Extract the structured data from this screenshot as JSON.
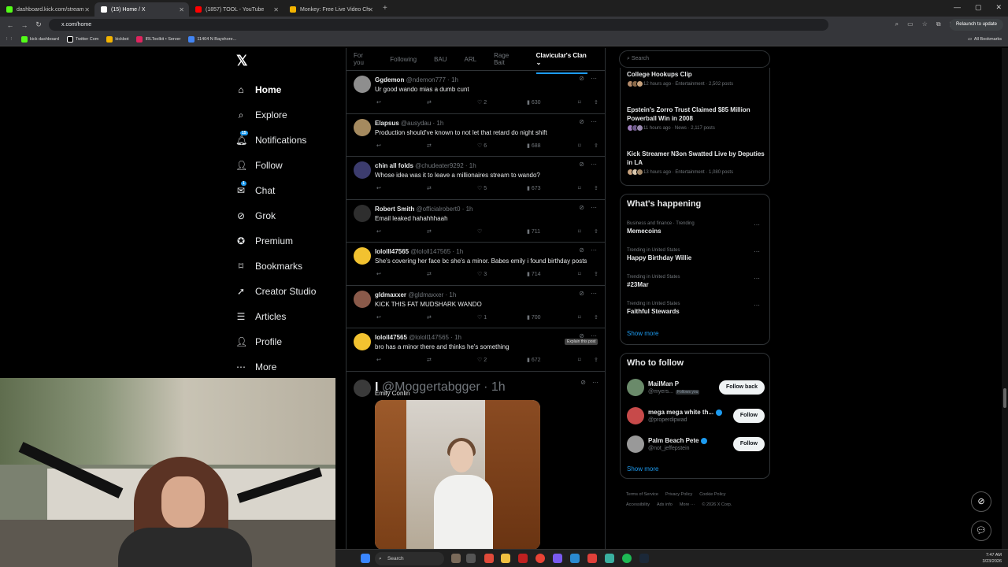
{
  "browser": {
    "tabs": [
      {
        "label": "dashboard.kick.com/stream",
        "color": "#53fc18"
      },
      {
        "label": "(15) Home / X",
        "color": "#ffffff"
      },
      {
        "label": "(1857) TOOL - YouTube",
        "color": "#ff0000"
      },
      {
        "label": "Monkey: Free Live Video Ch",
        "color": "#f4b400"
      }
    ],
    "url": "x.com/home",
    "relaunch": "Relaunch to update",
    "bookmarks": [
      "kick dashboard",
      "Twitter Com",
      "kickbot",
      "IRLToolkit • Server",
      "11404 N Bayshore..."
    ],
    "all_bookmarks": "All Bookmarks"
  },
  "nav": {
    "items": [
      {
        "label": "Home",
        "icon": "home-icon"
      },
      {
        "label": "Explore",
        "icon": "search-icon"
      },
      {
        "label": "Notifications",
        "icon": "bell-icon"
      },
      {
        "label": "Follow",
        "icon": "follow-icon"
      },
      {
        "label": "Chat",
        "icon": "mail-icon"
      },
      {
        "label": "Grok",
        "icon": "grok-icon"
      },
      {
        "label": "Premium",
        "icon": "premium-icon"
      },
      {
        "label": "Bookmarks",
        "icon": "bookmark-icon"
      },
      {
        "label": "Creator Studio",
        "icon": "rocket-icon"
      },
      {
        "label": "Articles",
        "icon": "article-icon"
      },
      {
        "label": "Profile",
        "icon": "profile-icon"
      },
      {
        "label": "More",
        "icon": "more-icon"
      }
    ]
  },
  "feed_tabs": [
    "For you",
    "Following",
    "BAU",
    "ARL",
    "Rage Bait",
    "Clavicular's Clan"
  ],
  "posts": [
    {
      "name": "Ggdemon",
      "handle": "@ndemon777 · 1h",
      "text": "Ur good wando mias a dumb cunt",
      "likes": "2",
      "views": "630",
      "avatar": "#8e8e8e"
    },
    {
      "name": "Elapsus",
      "handle": "@ausydau · 1h",
      "text": "Production should've known to not let that retard do night shift",
      "likes": "6",
      "views": "688",
      "avatar": "#a58a5f"
    },
    {
      "name": "chin all folds",
      "handle": "@chudeater9292 · 1h",
      "text": "Whose idea was it to leave a millionaires stream to wando?",
      "likes": "5",
      "views": "673",
      "avatar": "#3c3c6e"
    },
    {
      "name": "Robert Smith",
      "handle": "@officialrobert0 · 1h",
      "text": "Email leaked hahahhhaah",
      "likes": "",
      "views": "711",
      "avatar": "#2e2e2e"
    },
    {
      "name": "lololll47565",
      "handle": "@lololl147565 · 1h",
      "text": "She's covering her face bc she's a minor. Babes emily i found birthday posts",
      "likes": "3",
      "views": "714",
      "avatar": "#f2c230"
    },
    {
      "name": "gldmaxxer",
      "handle": "@gldmaxxer · 1h",
      "text": "KICK THIS FAT MUDSHARK WANDO",
      "likes": "1",
      "views": "700",
      "avatar": "#8a5a4a"
    },
    {
      "name": "lololl47565",
      "handle": "@lololl147565 · 1h",
      "text": "bro has a minor there and thinks he's something",
      "likes": "2",
      "views": "672",
      "avatar": "#f2c230"
    }
  ],
  "media_post": {
    "name": "I",
    "handle": "@Moggertabgger · 1h",
    "text": "Emily Conlin"
  },
  "tooltip": "Explain this post",
  "search_placeholder": "Search",
  "top_news": [
    {
      "title": "College Hookups Clip",
      "meta": "12 hours ago · Entertainment · 2,502 posts"
    },
    {
      "title": "Epstein's Zorro Trust Claimed $85 Million Powerball Win in 2008",
      "meta": "11 hours ago · News · 2,117 posts"
    },
    {
      "title": "Kick Streamer N3on Swatted Live by Deputies in LA",
      "meta": "13 hours ago · Entertainment · 1,080 posts"
    }
  ],
  "happening": {
    "title": "What's happening",
    "trends": [
      {
        "context": "Business and finance · Trending",
        "name": "Memecoins"
      },
      {
        "context": "Trending in United States",
        "name": "Happy Birthday Willie"
      },
      {
        "context": "Trending in United States",
        "name": "#23Mar"
      },
      {
        "context": "Trending in United States",
        "name": "Faithful Stewards"
      }
    ],
    "show_more": "Show more"
  },
  "who_to_follow": {
    "title": "Who to follow",
    "people": [
      {
        "name": "MailMan P",
        "handle": "@myers...",
        "badge": "Follows you",
        "button": "Follow back"
      },
      {
        "name": "mega mega white th...",
        "handle": "@properdipwad",
        "badge": "",
        "button": "Follow"
      },
      {
        "name": "Palm Beach Pete",
        "handle": "@not_jeffepstein",
        "badge": "",
        "button": "Follow"
      }
    ],
    "show_more": "Show more"
  },
  "footer": [
    "Terms of Service",
    "Privacy Policy",
    "Cookie Policy",
    "Accessibility",
    "Ads info",
    "More ···",
    "© 2026 X Corp."
  ],
  "taskbar": {
    "search": "Search",
    "time": "7:47 AM",
    "date": "3/23/2026"
  },
  "badges": {
    "notifications": "15",
    "chat": "1"
  }
}
